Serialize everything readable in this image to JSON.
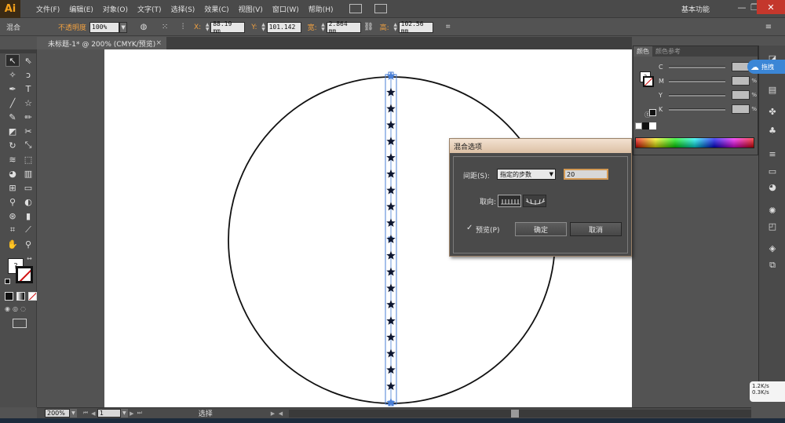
{
  "app": {
    "logo": "Ai",
    "workspace": "基本功能"
  },
  "menu": [
    "文件(F)",
    "编辑(E)",
    "对象(O)",
    "文字(T)",
    "选择(S)",
    "效果(C)",
    "视图(V)",
    "窗口(W)",
    "帮助(H)"
  ],
  "control_bar": {
    "object_type": "混合",
    "opacity_label": "不透明度",
    "opacity_value": "100%",
    "x_label": "X:",
    "x_value": "88.19 mm",
    "y_label": "Y:",
    "y_value": "101.142",
    "w_label": "宽:",
    "w_value": "2.864 mm",
    "h_label": "高:",
    "h_value": "102.56 mm"
  },
  "document": {
    "tab_title": "未标题-1* @ 200% (CMYK/预览)",
    "close": "×"
  },
  "status_bar": {
    "zoom": "200%",
    "page": "1",
    "status": "选择"
  },
  "color_panel": {
    "tab_color": "颜色",
    "tab_guide": "颜色参考",
    "channels": [
      {
        "label": "C",
        "unit": "%"
      },
      {
        "label": "M",
        "unit": "%"
      },
      {
        "label": "Y",
        "unit": "%"
      },
      {
        "label": "K",
        "unit": "%"
      }
    ]
  },
  "float_widget": {
    "label": "拖拽"
  },
  "net_widget": {
    "up": "1.2K/s",
    "down": "0.3K/s"
  },
  "blend_dialog": {
    "title": "混合选项",
    "spacing_label": "间距(S):",
    "spacing_mode": "指定的步数",
    "steps": "20",
    "orientation_label": "取向:",
    "preview_label": "预览(P)",
    "preview_checked": "✓",
    "ok_label": "确定",
    "cancel_label": "取消"
  },
  "canvas": {
    "star_count": 21,
    "artboard_color": "#ffffff",
    "selection_color": "#4a7fd6",
    "star_color": "#0d1630"
  }
}
